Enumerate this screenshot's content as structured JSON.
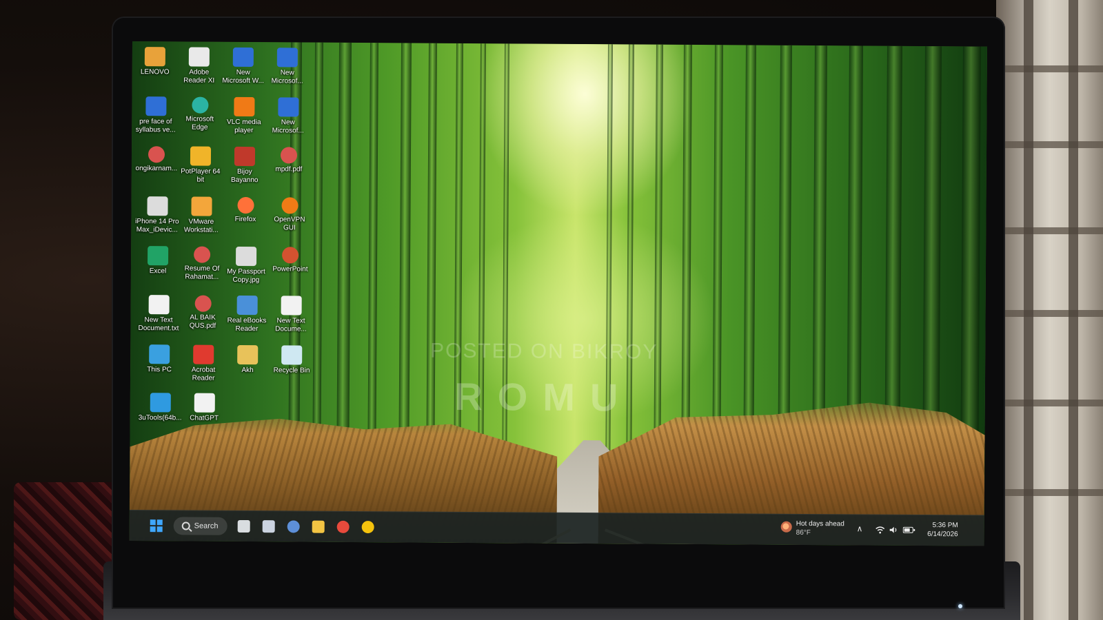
{
  "watermark": {
    "line1": "POSTED ON BIKROY",
    "line2": "ROMU"
  },
  "desktop": {
    "icons": [
      {
        "label": "LENOVO",
        "icon": "folder-icon",
        "color": "#e8a23a"
      },
      {
        "label": "Adobe\nReader XI",
        "icon": "document-icon",
        "color": "#e9e9e9"
      },
      {
        "label": "New\nMicrosoft W...",
        "icon": "word-icon",
        "color": "#2f6fd6"
      },
      {
        "label": "New\nMicrosof...",
        "icon": "word-icon",
        "color": "#2f6fd6"
      },
      {
        "label": "pre face of\nsyllabus ve...",
        "icon": "word-icon",
        "color": "#2f6fd6"
      },
      {
        "label": "Microsoft\nEdge",
        "icon": "edge-icon",
        "color": "#2bb3a3"
      },
      {
        "label": "VLC media\nplayer",
        "icon": "vlc-icon",
        "color": "#f07a16"
      },
      {
        "label": "New\nMicrosof...",
        "icon": "word-icon",
        "color": "#2f6fd6"
      },
      {
        "label": "ongikarnam...",
        "icon": "pdf-icon",
        "color": "#d9534f"
      },
      {
        "label": "PotPlayer 64\nbit",
        "icon": "potplayer-icon",
        "color": "#f0b429"
      },
      {
        "label": "Bijoy\nBayanno",
        "icon": "bijoy-icon",
        "color": "#c0392b"
      },
      {
        "label": "mpdf.pdf",
        "icon": "pdf-icon",
        "color": "#d9534f"
      },
      {
        "label": "iPhone 14 Pro\nMax_iDevic...",
        "icon": "image-icon",
        "color": "#dcdcdc"
      },
      {
        "label": "VMware\nWorkstati...",
        "icon": "vmware-icon",
        "color": "#f3a63b"
      },
      {
        "label": "Firefox",
        "icon": "firefox-icon",
        "color": "#ff7139"
      },
      {
        "label": "OpenVPN\nGUI",
        "icon": "openvpn-icon",
        "color": "#f07b16"
      },
      {
        "label": "Excel",
        "icon": "excel-icon",
        "color": "#21a366"
      },
      {
        "label": "Resume Of\nRahamat...",
        "icon": "pdf-icon",
        "color": "#d9534f"
      },
      {
        "label": "My Passport\nCopy.jpg",
        "icon": "image-icon",
        "color": "#dcdcdc"
      },
      {
        "label": "PowerPoint",
        "icon": "powerpoint-icon",
        "color": "#d35230"
      },
      {
        "label": "New Text\nDocument.txt",
        "icon": "text-file-icon",
        "color": "#f2f2f2"
      },
      {
        "label": "AL BAIK\nQUS.pdf",
        "icon": "pdf-icon",
        "color": "#d9534f"
      },
      {
        "label": "Real eBooks\nReader",
        "icon": "ebook-reader-icon",
        "color": "#4a90d9"
      },
      {
        "label": "New Text\nDocume...",
        "icon": "text-file-icon",
        "color": "#f2f2f2"
      },
      {
        "label": "This PC",
        "icon": "this-pc-icon",
        "color": "#3aa0e0"
      },
      {
        "label": "Acrobat\nReader",
        "icon": "acrobat-icon",
        "color": "#e03a2f"
      },
      {
        "label": "Akh",
        "icon": "folder-icon",
        "color": "#e8c25a"
      },
      {
        "label": "Recycle Bin",
        "icon": "recycle-bin-icon",
        "color": "#cfe8f2"
      },
      {
        "label": "3uTools(64b...",
        "icon": "3utools-icon",
        "color": "#2f9ae0"
      },
      {
        "label": "ChatGPT",
        "icon": "document-icon",
        "color": "#f2f2f2"
      }
    ]
  },
  "taskbar": {
    "search_label": "Search",
    "apps": [
      {
        "name": "task-view-icon",
        "color": "#d9dde0"
      },
      {
        "name": "widgets-store-icon",
        "color": "#cbd3e0"
      },
      {
        "name": "settings-icon",
        "color": "#5d8fd8"
      },
      {
        "name": "file-explorer-icon",
        "color": "#f3c443"
      },
      {
        "name": "chrome-icon",
        "color": "#e84a3c"
      },
      {
        "name": "chrome-icon",
        "color": "#f4c20d"
      }
    ],
    "weather": {
      "line1": "Hot days ahead",
      "line2": "86°F"
    },
    "clock": {
      "time": "5:36 PM",
      "date": "6/14/2026"
    }
  },
  "colors": {
    "accent": "#3fa7ff",
    "taskbar": "#1c2422"
  }
}
